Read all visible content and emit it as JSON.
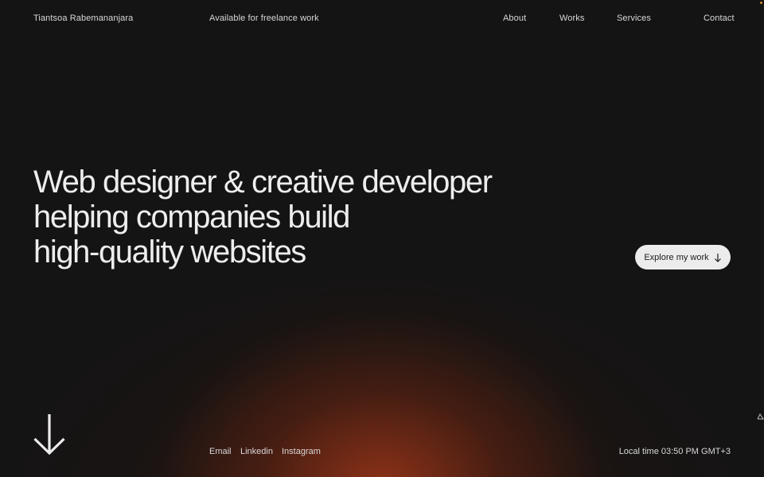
{
  "header": {
    "brand_name": "Tiantsoa Rabemananjara",
    "availability": "Available for freelance work",
    "nav": {
      "about": "About",
      "works": "Works",
      "services": "Services",
      "contact": "Contact"
    }
  },
  "hero": {
    "headline_lines": [
      "Web designer & creative developer",
      "helping companies build",
      "high-quality websites"
    ],
    "cta_label": "Explore my work",
    "cta_icon": "arrow-down-icon",
    "scroll_icon": "large-arrow-down-icon"
  },
  "footer": {
    "links": {
      "email": "Email",
      "linkedin": "Linkedin",
      "instagram": "Instagram"
    },
    "local_time": "Local time 03:50 PM GMT+3"
  },
  "colors": {
    "background": "#141414",
    "glow": "#a03719",
    "text": "#e6e6e6",
    "button_bg": "#ececec",
    "button_text": "#1a1a1a",
    "accent_dot": "#d08a2a"
  }
}
